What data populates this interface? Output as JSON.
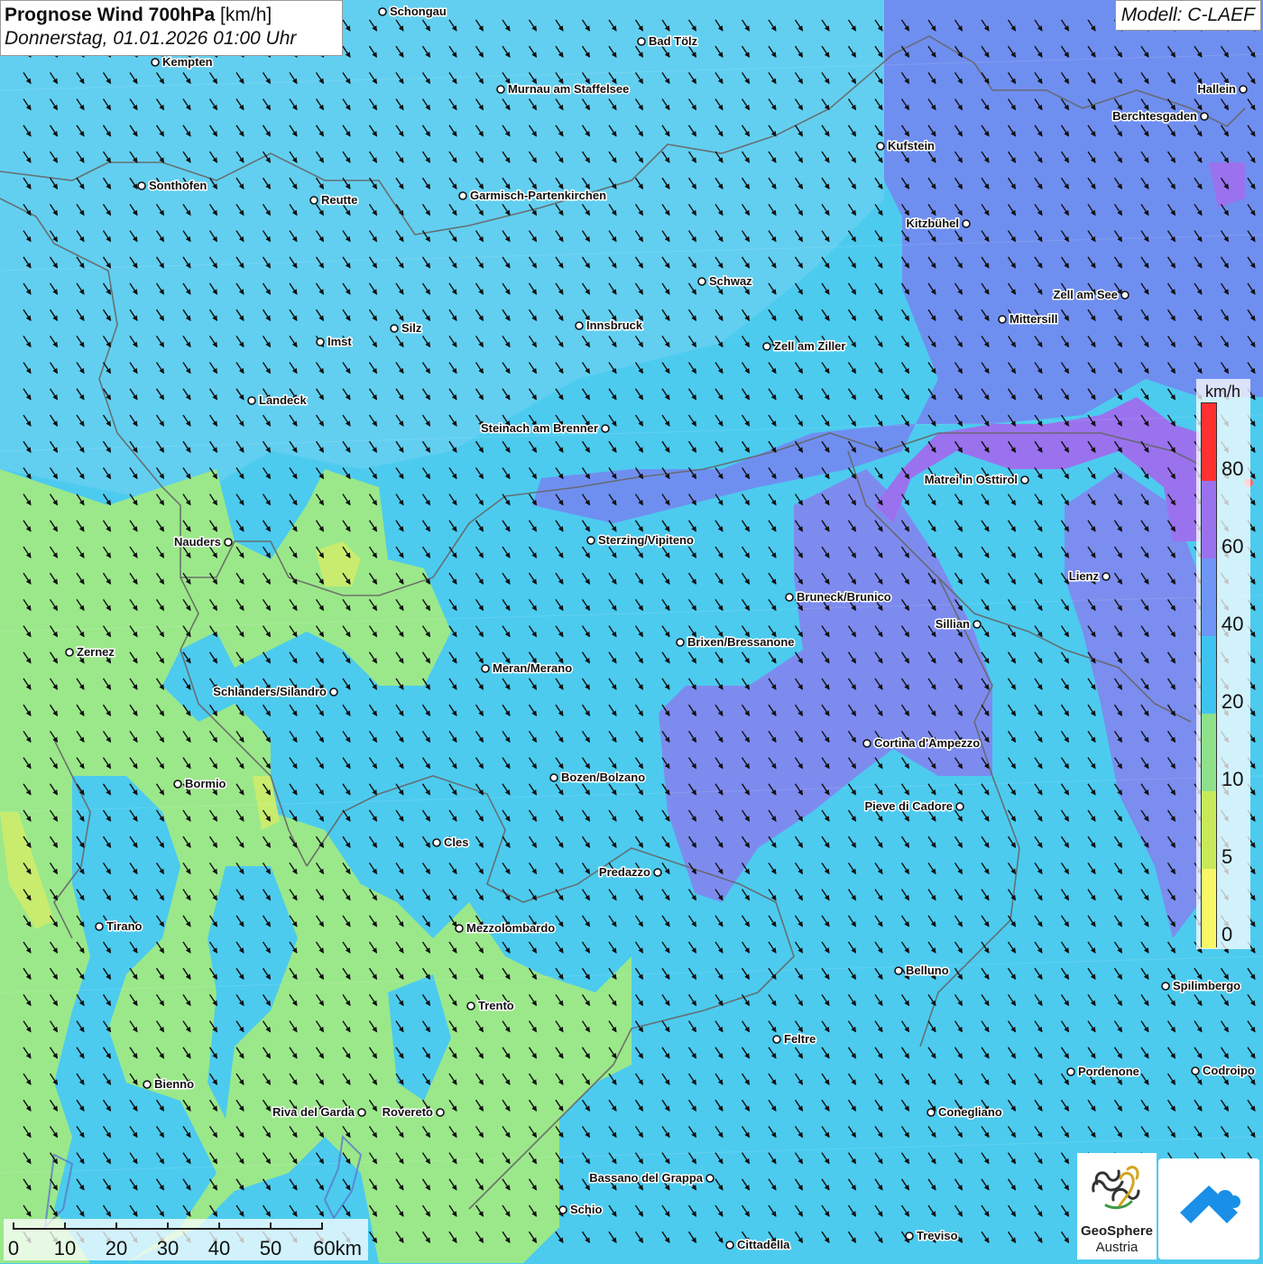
{
  "header": {
    "title_bold": "Prognose Wind 700hPa",
    "title_unit": "[km/h]",
    "subtitle": "Donnerstag, 01.01.2026 01:00 Uhr",
    "model": "Modell: C-LAEF"
  },
  "colors": {
    "background": "#4ccbef",
    "light_blue": "#66d1f0",
    "green": "#9be88a",
    "yellow_green": "#c9ec6e",
    "blue_violet": "#7f8ef0",
    "violet": "#9a72ee",
    "purple": "#a868ea",
    "red": "#ff3030",
    "arrow": "#111111",
    "border_line": "#666666"
  },
  "wind": {
    "direction": "north-west",
    "arrow_icon": "wind-arrow-southeast-icon"
  },
  "legend": {
    "unit": "km/h",
    "ticks": [
      "80",
      "60",
      "40",
      "20",
      "10",
      "5",
      "0"
    ],
    "colors": [
      "#ff3030",
      "#9a72ee",
      "#6f95f5",
      "#3fc3f0",
      "#8fe08b",
      "#c8ea5a",
      "#f7f767"
    ]
  },
  "scale_bar": {
    "labels": [
      "0",
      "10",
      "20",
      "30",
      "40",
      "50",
      "60km"
    ]
  },
  "logo": {
    "name": "GeoSphere",
    "sub": "Austria",
    "icon": "geosphere-logo-icon",
    "app_icon": "weather-app-icon"
  },
  "cities": [
    {
      "name": "Schongau",
      "label_side": "right"
    },
    {
      "name": "Bad Tölz",
      "label_side": "right"
    },
    {
      "name": "Kempten",
      "label_side": "right"
    },
    {
      "name": "Murnau am Staffelsee",
      "label_side": "right"
    },
    {
      "name": "Hallein",
      "label_side": "left"
    },
    {
      "name": "Berchtesgaden",
      "label_side": "left"
    },
    {
      "name": "Kufstein",
      "label_side": "right"
    },
    {
      "name": "Sonthofen",
      "label_side": "right"
    },
    {
      "name": "Reutte",
      "label_side": "right"
    },
    {
      "name": "Garmisch-Partenkirchen",
      "label_side": "right"
    },
    {
      "name": "Kitzbühel",
      "label_side": "left"
    },
    {
      "name": "Schwaz",
      "label_side": "right"
    },
    {
      "name": "Zell am See",
      "label_side": "left"
    },
    {
      "name": "Innsbruck",
      "label_side": "right"
    },
    {
      "name": "Silz",
      "label_side": "right"
    },
    {
      "name": "Mittersill",
      "label_side": "right"
    },
    {
      "name": "Imst",
      "label_side": "right"
    },
    {
      "name": "Zell am Ziller",
      "label_side": "right"
    },
    {
      "name": "Landeck",
      "label_side": "right"
    },
    {
      "name": "Steinach am Brenner",
      "label_side": "left"
    },
    {
      "name": "Matrei in Osttirol",
      "label_side": "left"
    },
    {
      "name": "Nauders",
      "label_side": "left"
    },
    {
      "name": "Sterzing/Vipiteno",
      "label_side": "right"
    },
    {
      "name": "Lienz",
      "label_side": "left"
    },
    {
      "name": "Bruneck/Brunico",
      "label_side": "right"
    },
    {
      "name": "Sillian",
      "label_side": "left"
    },
    {
      "name": "Brixen/Bressanone",
      "label_side": "right"
    },
    {
      "name": "Zernez",
      "label_side": "right"
    },
    {
      "name": "Meran/Merano",
      "label_side": "right"
    },
    {
      "name": "Schlanders/Silandro",
      "label_side": "left"
    },
    {
      "name": "Cortina d'Ampezzo",
      "label_side": "right"
    },
    {
      "name": "Bormio",
      "label_side": "right"
    },
    {
      "name": "Bozen/Bolzano",
      "label_side": "right"
    },
    {
      "name": "Pieve di Cadore",
      "label_side": "left"
    },
    {
      "name": "Cles",
      "label_side": "right"
    },
    {
      "name": "Predazzo",
      "label_side": "left"
    },
    {
      "name": "Tirano",
      "label_side": "right"
    },
    {
      "name": "Mezzolombardo",
      "label_side": "right"
    },
    {
      "name": "Belluno",
      "label_side": "right"
    },
    {
      "name": "Spilimbergo",
      "label_side": "right"
    },
    {
      "name": "Trento",
      "label_side": "right"
    },
    {
      "name": "Feltre",
      "label_side": "right"
    },
    {
      "name": "Pordenone",
      "label_side": "right"
    },
    {
      "name": "Codroipo",
      "label_side": "right"
    },
    {
      "name": "Bienno",
      "label_side": "right"
    },
    {
      "name": "Riva del Garda",
      "label_side": "left"
    },
    {
      "name": "Rovereto",
      "label_side": "left"
    },
    {
      "name": "Conegliano",
      "label_side": "right"
    },
    {
      "name": "Bassano del Grappa",
      "label_side": "left"
    },
    {
      "name": "Schio",
      "label_side": "right"
    },
    {
      "name": "Treviso",
      "label_side": "right"
    },
    {
      "name": "Cittadella",
      "label_side": "right"
    }
  ]
}
